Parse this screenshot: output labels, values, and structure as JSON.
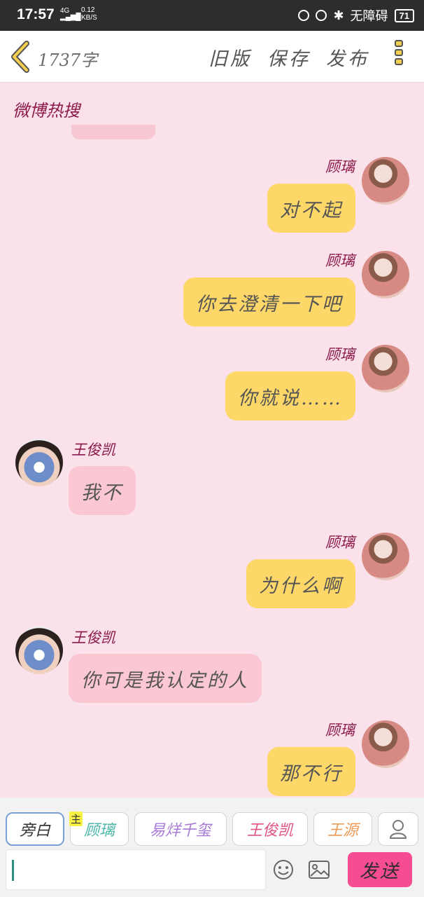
{
  "status_bar": {
    "time": "17:57",
    "network": "4G",
    "speed_value": "0.12",
    "speed_unit": "KB/S",
    "accessibility_label": "无障碍",
    "battery": "71"
  },
  "top_bar": {
    "word_count": "1737字",
    "actions": [
      "旧版",
      "保存",
      "发布"
    ]
  },
  "chat": {
    "header": "微博热搜",
    "messages": [
      {
        "side": "right",
        "name": "顾璃",
        "text": "对不起"
      },
      {
        "side": "right",
        "name": "顾璃",
        "text": "你去澄清一下吧"
      },
      {
        "side": "right",
        "name": "顾璃",
        "text": "你就说……"
      },
      {
        "side": "left",
        "name": "王俊凯",
        "text": "我不"
      },
      {
        "side": "right",
        "name": "顾璃",
        "text": "为什么啊"
      },
      {
        "side": "left",
        "name": "王俊凯",
        "text": "你可是我认定的人"
      },
      {
        "side": "right",
        "name": "顾璃",
        "text": "那不行"
      }
    ]
  },
  "roles": [
    {
      "label": "旁白",
      "color": "#333333",
      "active": true
    },
    {
      "label": "顾璃",
      "color": "#4bb7a8",
      "badge": "主"
    },
    {
      "label": "易烊千玺",
      "color": "#a77ad6"
    },
    {
      "label": "王俊凯",
      "color": "#e0547f"
    },
    {
      "label": "王源",
      "color": "#ef9b58"
    }
  ],
  "input": {
    "value": ""
  },
  "send_label": "发送",
  "colors": {
    "chat_bg": "#fae1ea",
    "right_bubble": "#fdd868",
    "left_bubble": "#fbc7d3",
    "send_button": "#f64d92"
  }
}
